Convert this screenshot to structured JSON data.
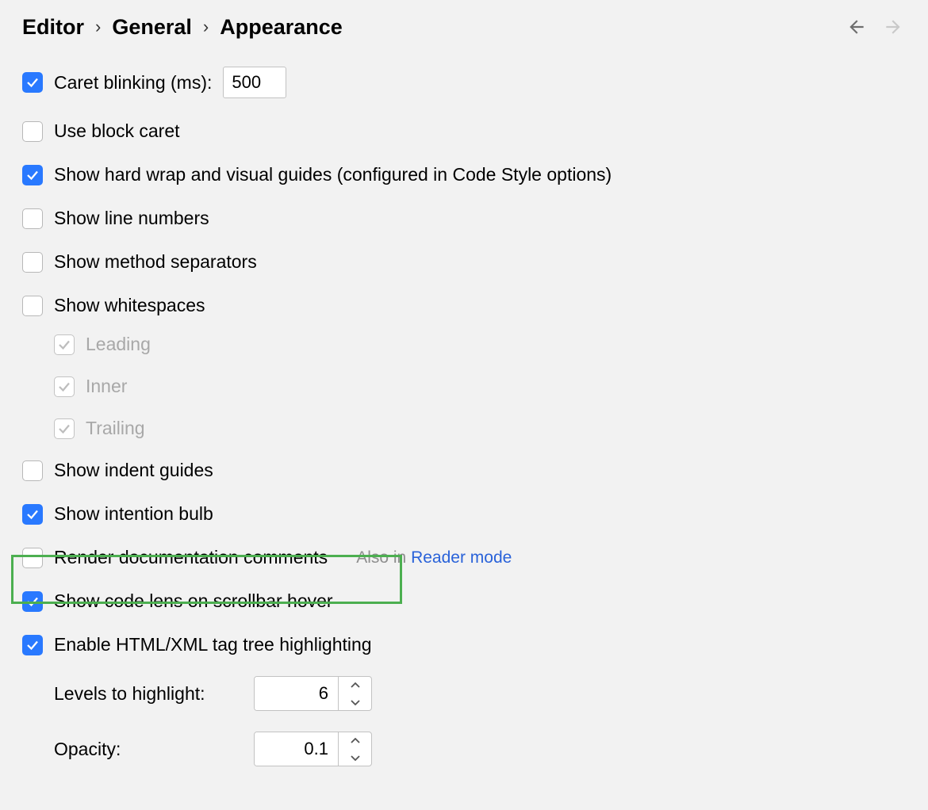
{
  "breadcrumb": {
    "item1": "Editor",
    "item2": "General",
    "item3": "Appearance"
  },
  "options": {
    "caret_blinking": {
      "label": "Caret blinking (ms):",
      "value": "500",
      "checked": true
    },
    "use_block_caret": {
      "label": "Use block caret",
      "checked": false
    },
    "show_hard_wrap": {
      "label": "Show hard wrap and visual guides (configured in Code Style options)",
      "checked": true
    },
    "show_line_numbers": {
      "label": "Show line numbers",
      "checked": false
    },
    "show_method_separators": {
      "label": "Show method separators",
      "checked": false
    },
    "show_whitespaces": {
      "label": "Show whitespaces",
      "checked": false
    },
    "ws_leading": {
      "label": "Leading",
      "checked": true
    },
    "ws_inner": {
      "label": "Inner",
      "checked": true
    },
    "ws_trailing": {
      "label": "Trailing",
      "checked": true
    },
    "show_indent_guides": {
      "label": "Show indent guides",
      "checked": false
    },
    "show_intention_bulb": {
      "label": "Show intention bulb",
      "checked": true
    },
    "render_doc_comments": {
      "label": "Render documentation comments",
      "checked": false,
      "hint_prefix": "Also in ",
      "hint_link": "Reader mode"
    },
    "show_code_lens": {
      "label": "Show code lens on scrollbar hover",
      "checked": true
    },
    "enable_tag_tree": {
      "label": "Enable HTML/XML tag tree highlighting",
      "checked": true
    },
    "levels_to_highlight": {
      "label": "Levels to highlight:",
      "value": "6"
    },
    "opacity": {
      "label": "Opacity:",
      "value": "0.1"
    }
  }
}
